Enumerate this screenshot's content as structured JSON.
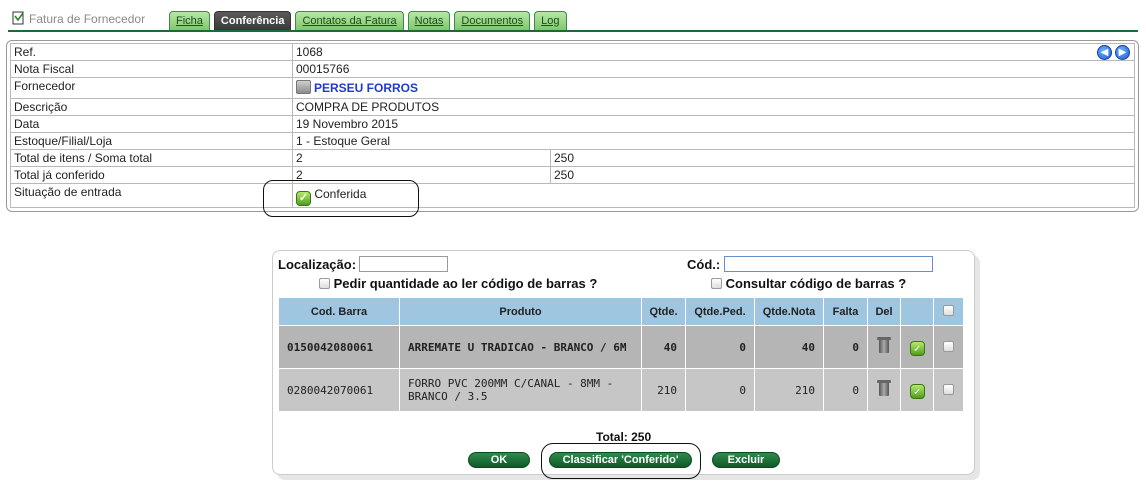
{
  "header": {
    "app_title": "Fatura de Fornecedor",
    "tabs": [
      {
        "label": "Ficha",
        "active": false
      },
      {
        "label": "Conferência",
        "active": true
      },
      {
        "label": "Contatos da Fatura",
        "active": false
      },
      {
        "label": "Notas",
        "active": false
      },
      {
        "label": "Documentos",
        "active": false
      },
      {
        "label": "Log",
        "active": false
      }
    ]
  },
  "nav": {
    "prev_icon": "arrow-left-icon",
    "next_icon": "arrow-right-icon"
  },
  "info": {
    "ref_label": "Ref.",
    "ref_value": "1068",
    "nf_label": "Nota Fiscal",
    "nf_value": "00015766",
    "supplier_label": "Fornecedor",
    "supplier_value": "PERSEU FORROS",
    "desc_label": "Descrição",
    "desc_value": "COMPRA DE PRODUTOS",
    "date_label": "Data",
    "date_value": "19 Novembro 2015",
    "store_label": "Estoque/Filial/Loja",
    "store_value": "1 - Estoque Geral",
    "total_items_label": "Total de itens / Soma total",
    "total_items_count": "2",
    "total_items_sum": "250",
    "checked_label": "Total já conferido",
    "checked_count": "2",
    "checked_sum": "250",
    "status_label": "Situação de entrada",
    "status_value": "Conferida"
  },
  "panel": {
    "location_label": "Localização:",
    "location_value": "",
    "code_label": "Cód.:",
    "code_value": "",
    "ask_qty_label": "Pedir quantidade ao ler código de barras ?",
    "lookup_label": "Consultar código de barras ?",
    "columns": [
      "Cod. Barra",
      "Produto",
      "Qtde.",
      "Qtde.Ped.",
      "Qtde.Nota",
      "Falta",
      "Del"
    ],
    "rows": [
      {
        "barcode": "0150042080061",
        "product": "ARREMATE U TRADICAO - BRANCO / 6M",
        "qty": "40",
        "qty_ordered": "0",
        "qty_invoice": "40",
        "missing": "0"
      },
      {
        "barcode": "0280042070061",
        "product": "FORRO PVC 200MM C/CANAL - 8MM - BRANCO / 3.5",
        "qty": "210",
        "qty_ordered": "0",
        "qty_invoice": "210",
        "missing": "0"
      }
    ],
    "total_text": "Total: 250",
    "ok_label": "OK",
    "classify_label": "Classificar 'Conferido'",
    "delete_label": "Excluir"
  }
}
